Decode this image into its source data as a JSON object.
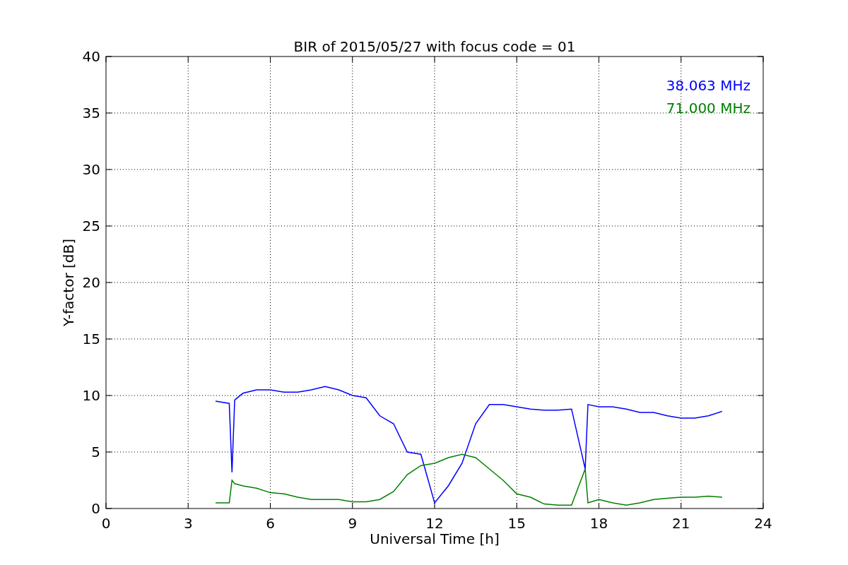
{
  "chart_data": {
    "type": "line",
    "title": "BIR of 2015/05/27 with focus code = 01",
    "xlabel": "Universal Time [h]",
    "ylabel": "Y-factor [dB]",
    "x": [
      4,
      4.5,
      4.6,
      4.7,
      5,
      5.5,
      6,
      6.5,
      7,
      7.5,
      8,
      8.5,
      9,
      9.5,
      10,
      10.5,
      11,
      11.5,
      12,
      12.5,
      13,
      13.5,
      14,
      14.5,
      15,
      15.5,
      16,
      16.5,
      17,
      17.5,
      17.6,
      18,
      18.5,
      19,
      19.5,
      20,
      20.5,
      21,
      21.5,
      22,
      22.5
    ],
    "series": [
      {
        "name": "38.063 MHz",
        "color": "#0000ff",
        "values": [
          9.5,
          9.3,
          3.2,
          9.6,
          10.2,
          10.5,
          10.5,
          10.3,
          10.3,
          10.5,
          10.8,
          10.5,
          10,
          9.8,
          8.2,
          7.5,
          5,
          4.8,
          0.5,
          2,
          4,
          7.5,
          9.2,
          9.2,
          9,
          8.8,
          8.7,
          8.7,
          8.8,
          3.5,
          9.2,
          9,
          9,
          8.8,
          8.5,
          8.5,
          8.2,
          8,
          8,
          8.2,
          8.6
        ]
      },
      {
        "name": "71.000 MHz",
        "color": "#008000",
        "values": [
          0.5,
          0.5,
          2.5,
          2.2,
          2,
          1.8,
          1.4,
          1.3,
          1,
          0.8,
          0.8,
          0.8,
          0.6,
          0.6,
          0.8,
          1.5,
          3,
          3.8,
          4,
          4.5,
          4.8,
          4.5,
          3.5,
          2.5,
          1.3,
          1,
          0.4,
          0.3,
          0.3,
          3.5,
          0.5,
          0.8,
          0.5,
          0.3,
          0.5,
          0.8,
          0.9,
          1,
          1,
          1.1,
          1
        ]
      }
    ],
    "grid": true,
    "xlim": [
      0,
      24
    ],
    "ylim": [
      0,
      40
    ],
    "xticks": [
      0,
      3,
      6,
      9,
      12,
      15,
      18,
      21,
      24
    ],
    "yticks": [
      0,
      5,
      10,
      15,
      20,
      25,
      30,
      35,
      40
    ]
  }
}
